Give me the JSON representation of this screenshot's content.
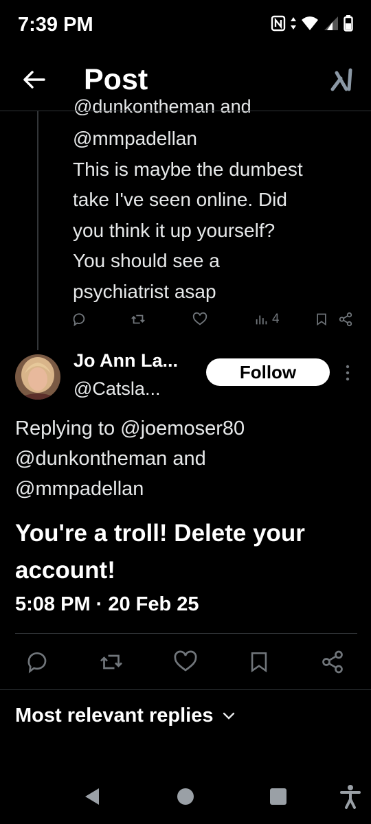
{
  "status_bar": {
    "time": "7:39 PM"
  },
  "header": {
    "title": "Post",
    "back_icon": "arrow-left-icon",
    "logo_icon": "x-logo-icon"
  },
  "parent_post": {
    "cut_off_line": "@dunkontheman and",
    "lines": [
      "@mmpadellan",
      "This is maybe the dumbest",
      "take I've seen online. Did",
      "you think it up yourself?",
      "You should see a",
      "psychiatrist asap"
    ],
    "views_count": "4"
  },
  "post": {
    "author_name": "Jo Ann La...",
    "author_handle": "@Catsla...",
    "follow_label": "Follow",
    "replying_to": [
      "Replying to @joemoser80",
      "@dunkontheman and",
      "@mmpadellan"
    ],
    "text": [
      "You're a troll! Delete your",
      "account!"
    ],
    "timestamp": "5:08 PM · 20 Feb 25"
  },
  "replies_sort": {
    "label": "Most relevant replies"
  },
  "colors": {
    "background": "#000000",
    "text": "#e7e9ea",
    "muted": "#71767b",
    "divider": "#2f3336"
  }
}
